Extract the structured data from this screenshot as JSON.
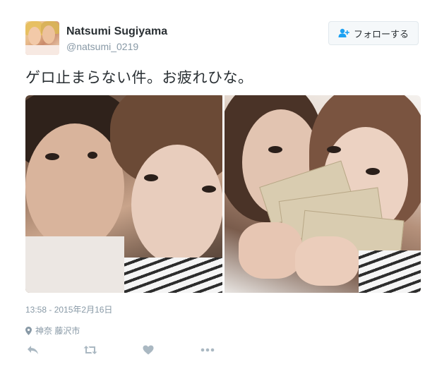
{
  "user": {
    "name": "Natsumi Sugiyama",
    "handle": "@natsumi_0219"
  },
  "follow_button": {
    "label": "フォローする",
    "icon": "add-user-icon"
  },
  "tweet": {
    "text": "ゲロ止まらない件。お疲れひな。",
    "timestamp": "13:58 - 2015年2月16日",
    "location": "神奈 藤沢市"
  },
  "actions": [
    {
      "name": "reply",
      "icon": "reply-icon"
    },
    {
      "name": "retweet",
      "icon": "retweet-icon"
    },
    {
      "name": "like",
      "icon": "heart-icon"
    },
    {
      "name": "more",
      "icon": "more-dots-icon"
    }
  ],
  "colors": {
    "text": "#292f33",
    "muted": "#8899a6",
    "icon": "#aab8c2",
    "accent": "#1da1f2"
  }
}
